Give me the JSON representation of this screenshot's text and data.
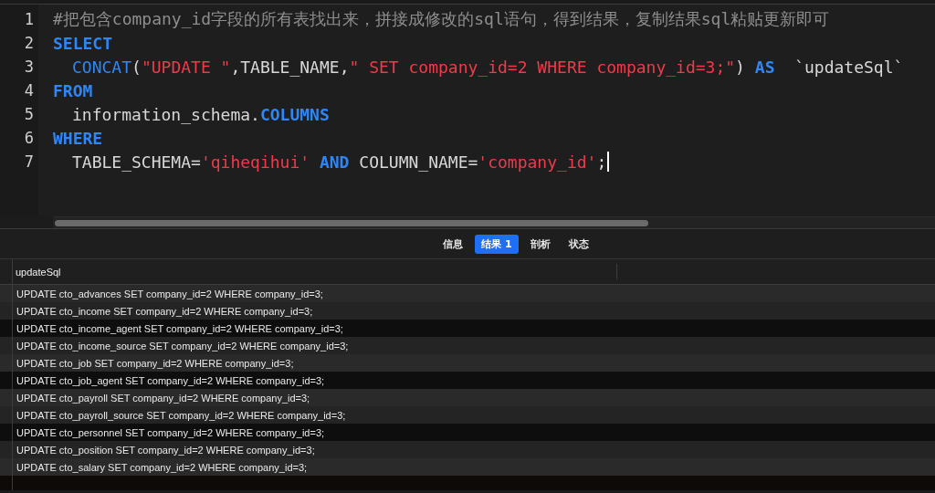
{
  "editor": {
    "lines": [
      {
        "number": "1",
        "tokens": [
          {
            "kind": "comment",
            "text": "#把包含company_id字段的所有表找出来，拼接成修改的sql语句，得到结果，复制结果sql粘贴更新即可"
          }
        ]
      },
      {
        "number": "2",
        "tokens": [
          {
            "kind": "keyword",
            "text": "SELECT"
          }
        ]
      },
      {
        "number": "3",
        "indent": true,
        "tokens": [
          {
            "kind": "function",
            "text": "CONCAT"
          },
          {
            "kind": "plain",
            "text": "("
          },
          {
            "kind": "string",
            "text": "\"UPDATE \""
          },
          {
            "kind": "plain",
            "text": ",TABLE_NAME,"
          },
          {
            "kind": "string",
            "text": "\" SET company_id=2 WHERE company_id=3;\""
          },
          {
            "kind": "plain",
            "text": ") "
          },
          {
            "kind": "keyword",
            "text": "AS"
          },
          {
            "kind": "plain",
            "text": "  `updateSql`"
          }
        ]
      },
      {
        "number": "4",
        "tokens": [
          {
            "kind": "keyword",
            "text": "FROM"
          }
        ]
      },
      {
        "number": "5",
        "indent": true,
        "tokens": [
          {
            "kind": "plain",
            "text": "information_schema."
          },
          {
            "kind": "keyword",
            "text": "COLUMNS"
          }
        ]
      },
      {
        "number": "6",
        "tokens": [
          {
            "kind": "keyword",
            "text": "WHERE"
          }
        ]
      },
      {
        "number": "7",
        "indent": true,
        "cursor": true,
        "tokens": [
          {
            "kind": "plain",
            "text": "TABLE_SCHEMA="
          },
          {
            "kind": "string",
            "text": "'qiheqihui' "
          },
          {
            "kind": "keyword",
            "text": "AND"
          },
          {
            "kind": "plain",
            "text": " COLUMN_NAME="
          },
          {
            "kind": "string",
            "text": "'company_id'"
          },
          {
            "kind": "plain",
            "text": ";"
          }
        ]
      }
    ]
  },
  "tabs": [
    {
      "label": "信息",
      "selected": false
    },
    {
      "label": "结果 1",
      "selected": true
    },
    {
      "label": "剖析",
      "selected": false
    },
    {
      "label": "状态",
      "selected": false
    }
  ],
  "results": {
    "columns": [
      "updateSql"
    ],
    "rows": [
      "UPDATE cto_advances SET company_id=2 WHERE company_id=3;",
      "UPDATE cto_income SET company_id=2 WHERE company_id=3;",
      "UPDATE cto_income_agent SET company_id=2 WHERE company_id=3;",
      "UPDATE cto_income_source SET company_id=2 WHERE company_id=3;",
      "UPDATE cto_job SET company_id=2 WHERE company_id=3;",
      "UPDATE cto_job_agent SET company_id=2 WHERE company_id=3;",
      "UPDATE cto_payroll SET company_id=2 WHERE company_id=3;",
      "UPDATE cto_payroll_source SET company_id=2 WHERE company_id=3;",
      "UPDATE cto_personnel SET company_id=2 WHERE company_id=3;",
      "UPDATE cto_position SET company_id=2 WHERE company_id=3;",
      "UPDATE cto_salary SET company_id=2 WHERE company_id=3;"
    ]
  }
}
